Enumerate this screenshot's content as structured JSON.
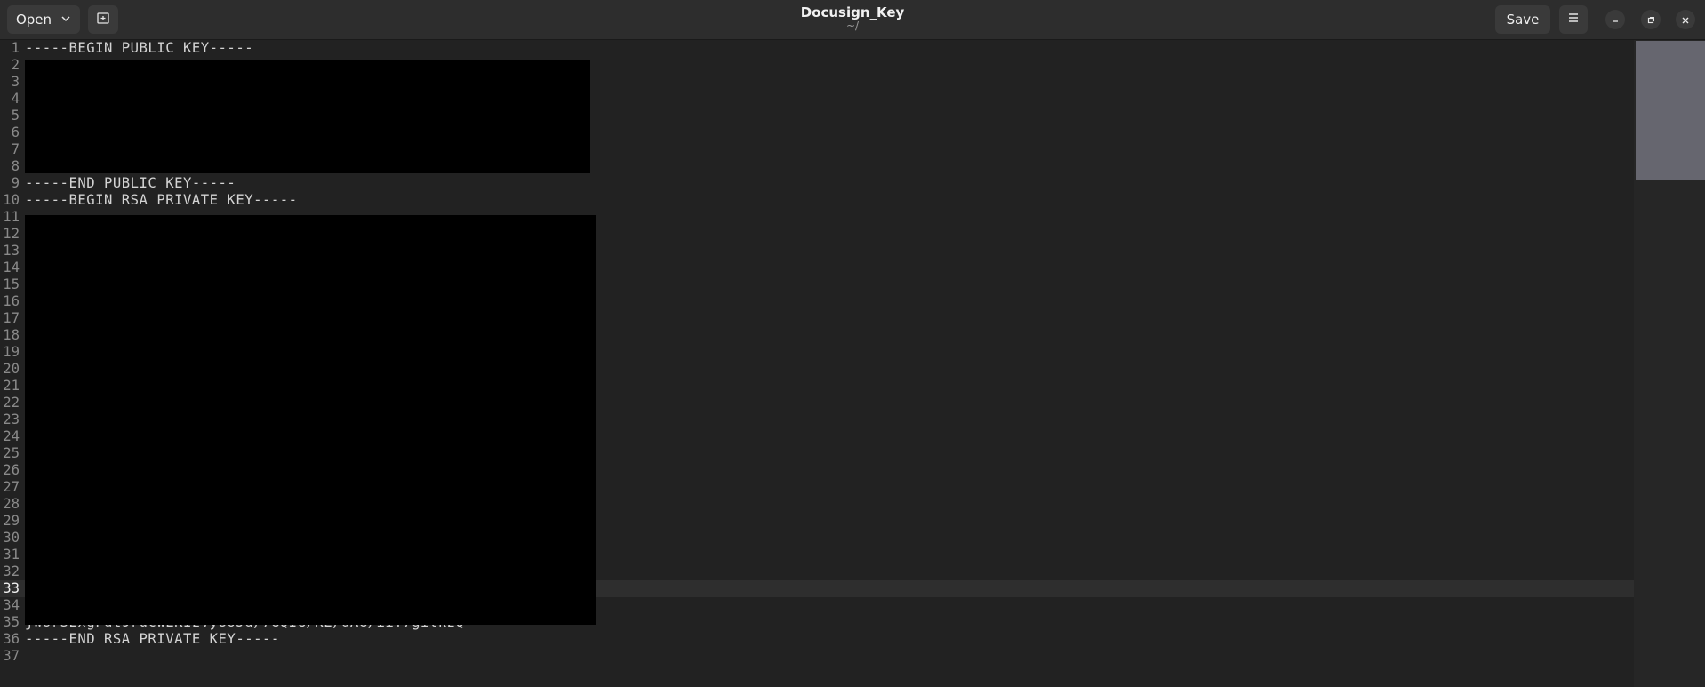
{
  "header": {
    "open_label": "Open",
    "title": "Docusign_Key",
    "subtitle": "~/",
    "save_label": "Save",
    "icons": {
      "open_dropdown": "chevron-down-icon",
      "new_tab": "new-tab-icon",
      "menu": "hamburger-menu-icon",
      "minimize": "minimize-icon",
      "maximize": "maximize-icon",
      "close": "close-icon"
    }
  },
  "editor": {
    "current_line": 33,
    "lines": [
      {
        "n": "1",
        "text": "-----BEGIN PUBLIC KEY-----"
      },
      {
        "n": "2",
        "text": ""
      },
      {
        "n": "3",
        "text": ""
      },
      {
        "n": "4",
        "text": ""
      },
      {
        "n": "5",
        "text": ""
      },
      {
        "n": "6",
        "text": ""
      },
      {
        "n": "7",
        "text": ""
      },
      {
        "n": "8",
        "text": ""
      },
      {
        "n": "9",
        "text": "-----END PUBLIC KEY-----"
      },
      {
        "n": "10",
        "text": "-----BEGIN RSA PRIVATE KEY-----"
      },
      {
        "n": "11",
        "text": ""
      },
      {
        "n": "12",
        "text": ""
      },
      {
        "n": "13",
        "text": ""
      },
      {
        "n": "14",
        "text": ""
      },
      {
        "n": "15",
        "text": ""
      },
      {
        "n": "16",
        "text": ""
      },
      {
        "n": "17",
        "text": ""
      },
      {
        "n": "18",
        "text": ""
      },
      {
        "n": "19",
        "text": ""
      },
      {
        "n": "20",
        "text": ""
      },
      {
        "n": "21",
        "text": ""
      },
      {
        "n": "22",
        "text": ""
      },
      {
        "n": "23",
        "text": ""
      },
      {
        "n": "24",
        "text": ""
      },
      {
        "n": "25",
        "text": ""
      },
      {
        "n": "26",
        "text": ""
      },
      {
        "n": "27",
        "text": ""
      },
      {
        "n": "28",
        "text": ""
      },
      {
        "n": "29",
        "text": ""
      },
      {
        "n": "30",
        "text": ""
      },
      {
        "n": "31",
        "text": ""
      },
      {
        "n": "32",
        "text": ""
      },
      {
        "n": "33",
        "text": ""
      },
      {
        "n": "34",
        "text": ""
      },
      {
        "n": "35",
        "text": "jwUrSExgFdt9rucwEKIzVy8oJd/7GQIG/KE/dAG/iiT7gitkzQ=="
      },
      {
        "n": "36",
        "text": "-----END RSA PRIVATE KEY-----"
      },
      {
        "n": "37",
        "text": ""
      }
    ]
  },
  "colors": {
    "background": "#222222",
    "headerbar": "#2d2d2d",
    "text": "#d4d4d4",
    "line_number": "#8a8a8a",
    "redaction": "#000000",
    "minimap_thumb": "#6e6e78"
  }
}
